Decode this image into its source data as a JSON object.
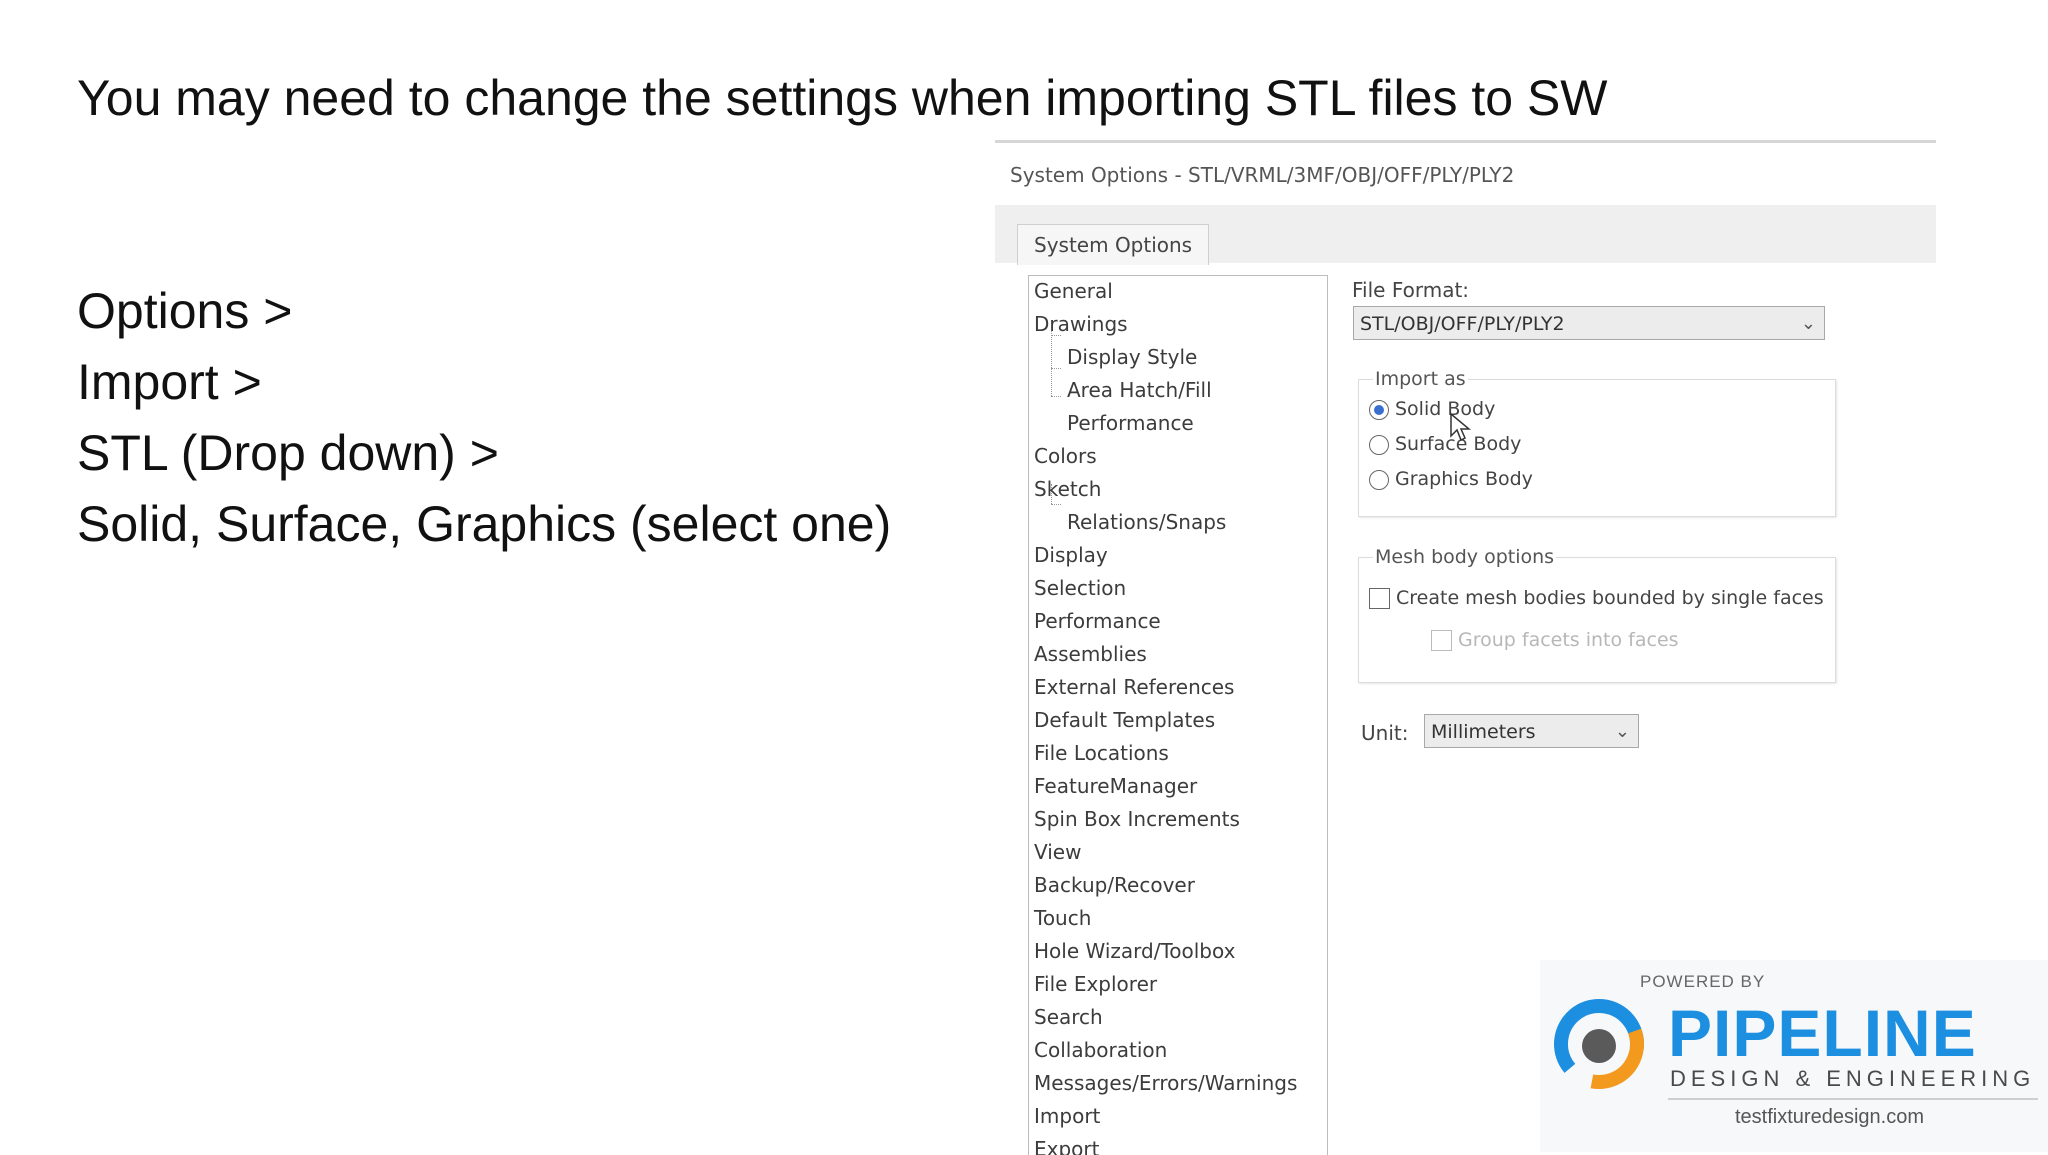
{
  "slide": {
    "title": "You may need to change the settings when importing STL files to SW",
    "steps": [
      "Options >",
      "Import >",
      "STL (Drop down) >",
      "Solid, Surface, Graphics (select one)"
    ]
  },
  "dialog": {
    "title": "System Options - STL/VRML/3MF/OBJ/OFF/PLY/PLY2",
    "tab": "System Options",
    "tree_items": [
      {
        "label": "General",
        "indent": 0
      },
      {
        "label": "Drawings",
        "indent": 0
      },
      {
        "label": "Display Style",
        "indent": 1
      },
      {
        "label": "Area Hatch/Fill",
        "indent": 1
      },
      {
        "label": "Performance",
        "indent": 1
      },
      {
        "label": "Colors",
        "indent": 0
      },
      {
        "label": "Sketch",
        "indent": 0
      },
      {
        "label": "Relations/Snaps",
        "indent": 1
      },
      {
        "label": "Display",
        "indent": 0
      },
      {
        "label": "Selection",
        "indent": 0
      },
      {
        "label": "Performance",
        "indent": 0
      },
      {
        "label": "Assemblies",
        "indent": 0
      },
      {
        "label": "External References",
        "indent": 0
      },
      {
        "label": "Default Templates",
        "indent": 0
      },
      {
        "label": "File Locations",
        "indent": 0
      },
      {
        "label": "FeatureManager",
        "indent": 0
      },
      {
        "label": "Spin Box Increments",
        "indent": 0
      },
      {
        "label": "View",
        "indent": 0
      },
      {
        "label": "Backup/Recover",
        "indent": 0
      },
      {
        "label": "Touch",
        "indent": 0
      },
      {
        "label": "Hole Wizard/Toolbox",
        "indent": 0
      },
      {
        "label": "File Explorer",
        "indent": 0
      },
      {
        "label": "Search",
        "indent": 0
      },
      {
        "label": "Collaboration",
        "indent": 0
      },
      {
        "label": "Messages/Errors/Warnings",
        "indent": 0
      },
      {
        "label": "Import",
        "indent": 0
      },
      {
        "label": "Export",
        "indent": 0
      }
    ],
    "file_format_label": "File Format:",
    "file_format_value": "STL/OBJ/OFF/PLY/PLY2",
    "import_as": {
      "label": "Import as",
      "options": [
        "Solid Body",
        "Surface Body",
        "Graphics Body"
      ],
      "selected": "Solid Body"
    },
    "mesh_options": {
      "label": "Mesh body options",
      "create_label": "Create mesh bodies bounded by single faces",
      "group_label": "Group facets into faces"
    },
    "unit_label": "Unit:",
    "unit_value": "Millimeters"
  },
  "logo": {
    "powered_by": "POWERED BY",
    "brand": "PIPELINE",
    "tagline": "DESIGN & ENGINEERING",
    "site": "testfixturedesign.com",
    "colors": {
      "brand_blue": "#1d8fe0",
      "accent_orange": "#f39a1e",
      "mark_gray": "#5a5a5a"
    }
  }
}
